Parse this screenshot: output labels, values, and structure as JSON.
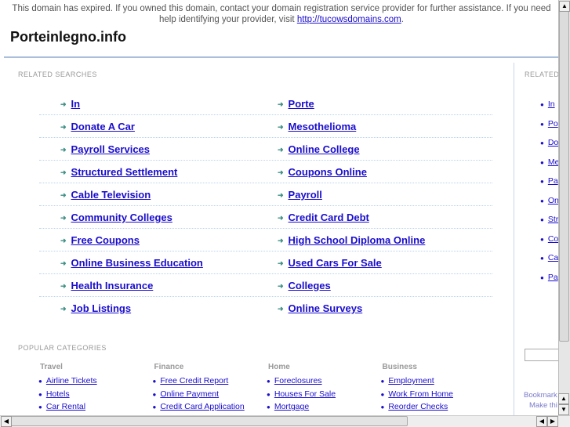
{
  "notice": {
    "text": "This domain has expired. If you owned this domain, contact your domain registration service provider for further assistance. If you need help identifying your provider, visit ",
    "link": "http://tucowsdomains.com",
    "end": "."
  },
  "title": "Porteinlegno.info",
  "related": {
    "label": "RELATED SEARCHES",
    "left": [
      "In",
      "Donate A Car",
      "Payroll Services",
      "Structured Settlement",
      "Cable Television",
      "Community Colleges",
      "Free Coupons",
      "Online Business Education",
      "Health Insurance",
      "Job Listings"
    ],
    "right": [
      "Porte",
      "Mesothelioma",
      "Online College",
      "Coupons Online",
      "Payroll",
      "Credit Card Debt",
      "High School Diploma Online",
      "Used Cars For Sale",
      "Colleges",
      "Online Surveys"
    ]
  },
  "sidebar": {
    "label": "RELATED",
    "items": [
      "In",
      "Po",
      "Do",
      "Me",
      "Pa",
      "On",
      "Str",
      "Co",
      "Ca",
      "Pa"
    ],
    "bookmark": "Bookmark",
    "make": "Make thi"
  },
  "popular": {
    "label": "POPULAR CATEGORIES",
    "categories": [
      {
        "name": "Travel",
        "items": [
          "Airline Tickets",
          "Hotels",
          "Car Rental"
        ]
      },
      {
        "name": "Finance",
        "items": [
          "Free Credit Report",
          "Online Payment",
          "Credit Card Application"
        ]
      },
      {
        "name": "Home",
        "items": [
          "Foreclosures",
          "Houses For Sale",
          "Mortgage"
        ]
      },
      {
        "name": "Business",
        "items": [
          "Employment",
          "Work From Home",
          "Reorder Checks"
        ]
      }
    ]
  },
  "colors": {
    "link": "#1a0dcc",
    "arrow": "#3d8f84",
    "rule": "#a9bfdc"
  }
}
